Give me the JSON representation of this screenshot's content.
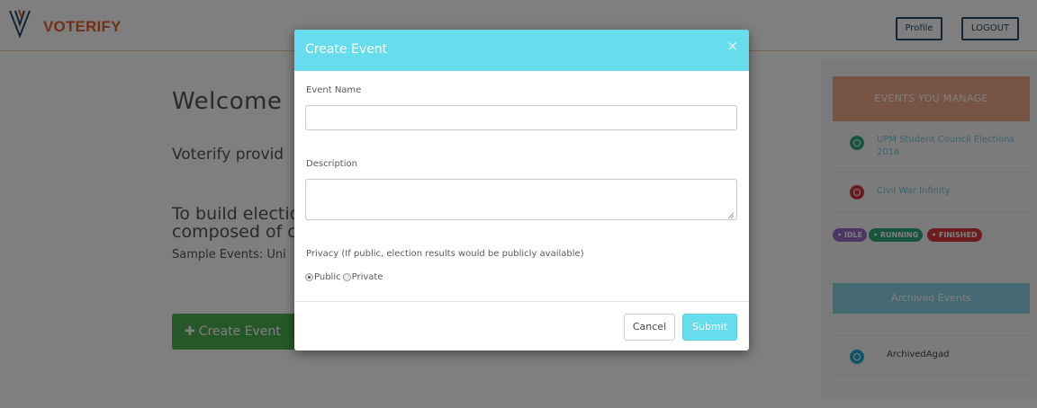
{
  "navbar": {
    "brand": "VOTERIFY",
    "profile_label": "Profile",
    "logout_label": "LOGOUT"
  },
  "main": {
    "welcome_text": "Welcome",
    "provides_text": "Voterify provid",
    "build_line1": "To build electio",
    "build_line2": "composed of c",
    "sample_text": "Sample Events: Uni",
    "create_label": "Create Event",
    "create_icon": "plus-icon"
  },
  "sidebar": {
    "manage_title": "EVENTS YOU MANAGE",
    "events": [
      {
        "name": "UPM Student Council Elections 2016",
        "status": "running"
      },
      {
        "name": "Civil War Infinity",
        "status": "finished"
      }
    ],
    "legend": [
      {
        "label": "• IDLE",
        "color": "#9b6bc9"
      },
      {
        "label": "• RUNNING",
        "color": "#2fa97a"
      },
      {
        "label": "• FINISHED",
        "color": "#d9363e"
      }
    ],
    "archived_title": "Archived Events",
    "archived": [
      {
        "name": "ArchivedAgad",
        "status": "archived"
      }
    ]
  },
  "colors": {
    "brand": "#e0632d",
    "modal_header": "#66dced",
    "running": "#2fa97a",
    "finished": "#d9363e",
    "archived": "#29a9d6"
  },
  "modal": {
    "title": "Create Event",
    "close": "×",
    "event_name_label": "Event Name",
    "event_name_value": "",
    "description_label": "Description",
    "description_value": "",
    "privacy_label": "Privacy (If public, election results would be publicly available)",
    "privacy_options": [
      "Public",
      "Private"
    ],
    "privacy_selected": "Public",
    "cancel_label": "Cancel",
    "submit_label": "Submit"
  }
}
